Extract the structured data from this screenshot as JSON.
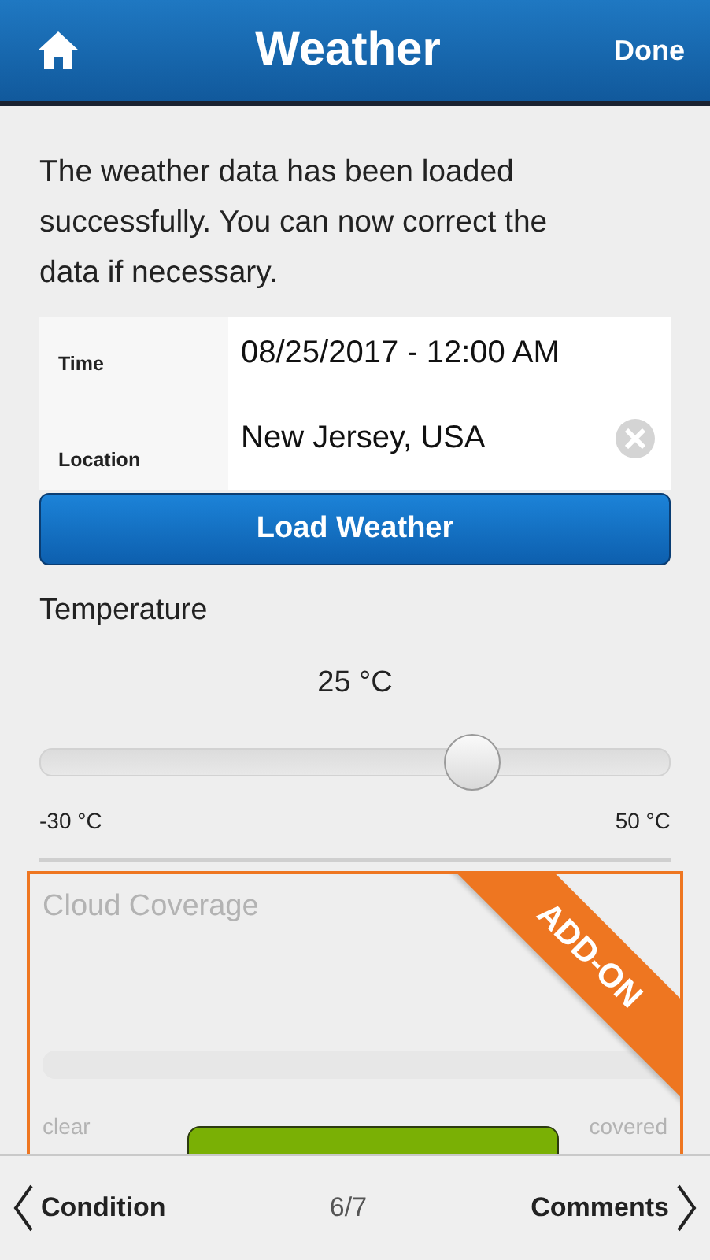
{
  "header": {
    "title": "Weather",
    "done": "Done"
  },
  "intro": "The weather data has been loaded successfully. You can now correct the data if necessary.",
  "fields": [
    {
      "label": "Time",
      "value": "08/25/2017 - 12:00 AM",
      "clearable": false
    },
    {
      "label": "Location",
      "value": "New Jersey, USA",
      "clearable": true
    }
  ],
  "load_button": "Load Weather",
  "temperature": {
    "label": "Temperature",
    "reading": "25 °C",
    "level": 0.6875,
    "min_label": "-30 °C",
    "max_label": "50 °C"
  },
  "addon": {
    "title": "Cloud Coverage",
    "ribbon": "ADD-ON",
    "disabled": true,
    "min_label": "clear",
    "max_label": "covered"
  },
  "footer": {
    "previous": "Condition",
    "page": "6/7",
    "next": "Comments"
  }
}
